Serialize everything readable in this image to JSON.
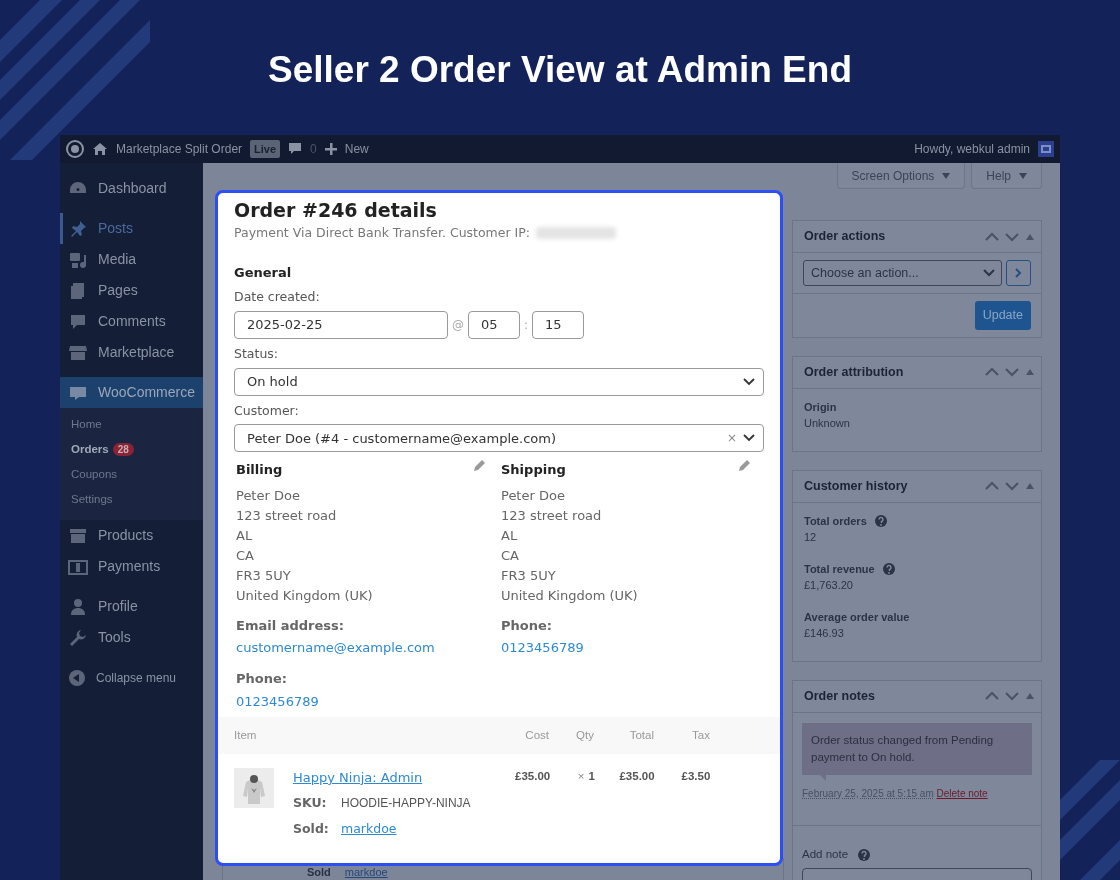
{
  "headline": "Seller 2 Order View at Admin End",
  "admin_bar": {
    "site_name": "Marketplace Split Order",
    "badge": "Live",
    "comments_count": "0",
    "new_label": "New",
    "greeting": "Howdy, webkul admin"
  },
  "sidebar": {
    "groups": [
      [
        {
          "label": "Dashboard",
          "selected": false,
          "hovered": false
        }
      ],
      [
        {
          "label": "Posts",
          "selected": false,
          "hovered": true
        },
        {
          "label": "Media",
          "selected": false,
          "hovered": false
        },
        {
          "label": "Pages",
          "selected": false,
          "hovered": false
        },
        {
          "label": "Comments",
          "selected": false,
          "hovered": false
        },
        {
          "label": "Marketplace",
          "selected": false,
          "hovered": false
        }
      ],
      [
        {
          "label": "WooCommerce",
          "selected": true,
          "hovered": false,
          "children": [
            {
              "label": "Home",
              "selected": false
            },
            {
              "label": "Orders",
              "selected": true,
              "count": "28"
            },
            {
              "label": "Coupons",
              "selected": false
            },
            {
              "label": "Settings",
              "selected": false
            }
          ]
        },
        {
          "label": "Products",
          "selected": false,
          "hovered": false
        },
        {
          "label": "Payments",
          "selected": false,
          "hovered": false
        }
      ],
      [
        {
          "label": "Profile",
          "selected": false,
          "hovered": false
        },
        {
          "label": "Tools",
          "selected": false,
          "hovered": false
        }
      ]
    ],
    "collapse_label": "Collapse menu"
  },
  "screen_buttons": [
    "Screen Options",
    "Help"
  ],
  "order_modal": {
    "title": "Order #246 details",
    "subtitle": "Payment Via Direct Bank Transfer. Customer IP:",
    "general_heading": "General",
    "date_label": "Date created:",
    "date": "2025-02-25",
    "at": "@",
    "hour": "05",
    "time_separator": ":",
    "minute": "15",
    "status_label": "Status:",
    "status": "On hold",
    "customer_label": "Customer:",
    "customer": "Peter Doe (#4 - customername@example.com)",
    "clear": "×",
    "billing": {
      "heading": "Billing",
      "lines": [
        "Peter Doe",
        "123 street road",
        "AL",
        "CA",
        "FR3 5UY",
        "United Kingdom (UK)"
      ],
      "contacts": [
        {
          "label": "Email address:",
          "value": "customername@example.com"
        },
        {
          "label": "Phone:",
          "value": "0123456789"
        }
      ]
    },
    "shipping": {
      "heading": "Shipping",
      "lines": [
        "Peter Doe",
        "123 street road",
        "AL",
        "CA",
        "FR3 5UY",
        "United Kingdom (UK)"
      ],
      "contacts": [
        {
          "label": "Phone:",
          "value": "0123456789"
        }
      ]
    },
    "items_table": {
      "columns": [
        "Item",
        "Cost",
        "Qty",
        "Total",
        "Tax"
      ],
      "rows": [
        {
          "name": "Happy Ninja: Admin",
          "sku_label": "SKU:",
          "sku": "HOODIE-HAPPY-NINJA",
          "sold_label": "Sold:",
          "seller": "markdoe",
          "cost": "£35.00",
          "qty_prefix": "×",
          "qty": "1",
          "total": "£35.00",
          "tax": "£3.50"
        }
      ]
    }
  },
  "background_item": {
    "sold_label": "Sold",
    "seller": "markdoe"
  },
  "metaboxes": [
    {
      "kind": "actions",
      "title": "Order actions",
      "select": "Choose an action...",
      "button": "Update"
    },
    {
      "kind": "fields",
      "title": "Order attribution",
      "fields": [
        {
          "label": "Origin",
          "value": "Unknown",
          "help": false
        }
      ]
    },
    {
      "kind": "fields",
      "title": "Customer history",
      "fields": [
        {
          "label": "Total orders",
          "value": "12",
          "help": true
        },
        {
          "label": "Total revenue",
          "value": "£1,763.20",
          "help": true
        },
        {
          "label": "Average order value",
          "value": "£146.93",
          "help": false
        }
      ]
    },
    {
      "kind": "notes",
      "title": "Order notes",
      "note": "Order status changed from Pending payment to On hold.",
      "note_date": "February 25, 2025 at 5:15 am",
      "delete_label": "Delete note",
      "add_label": "Add note"
    }
  ]
}
